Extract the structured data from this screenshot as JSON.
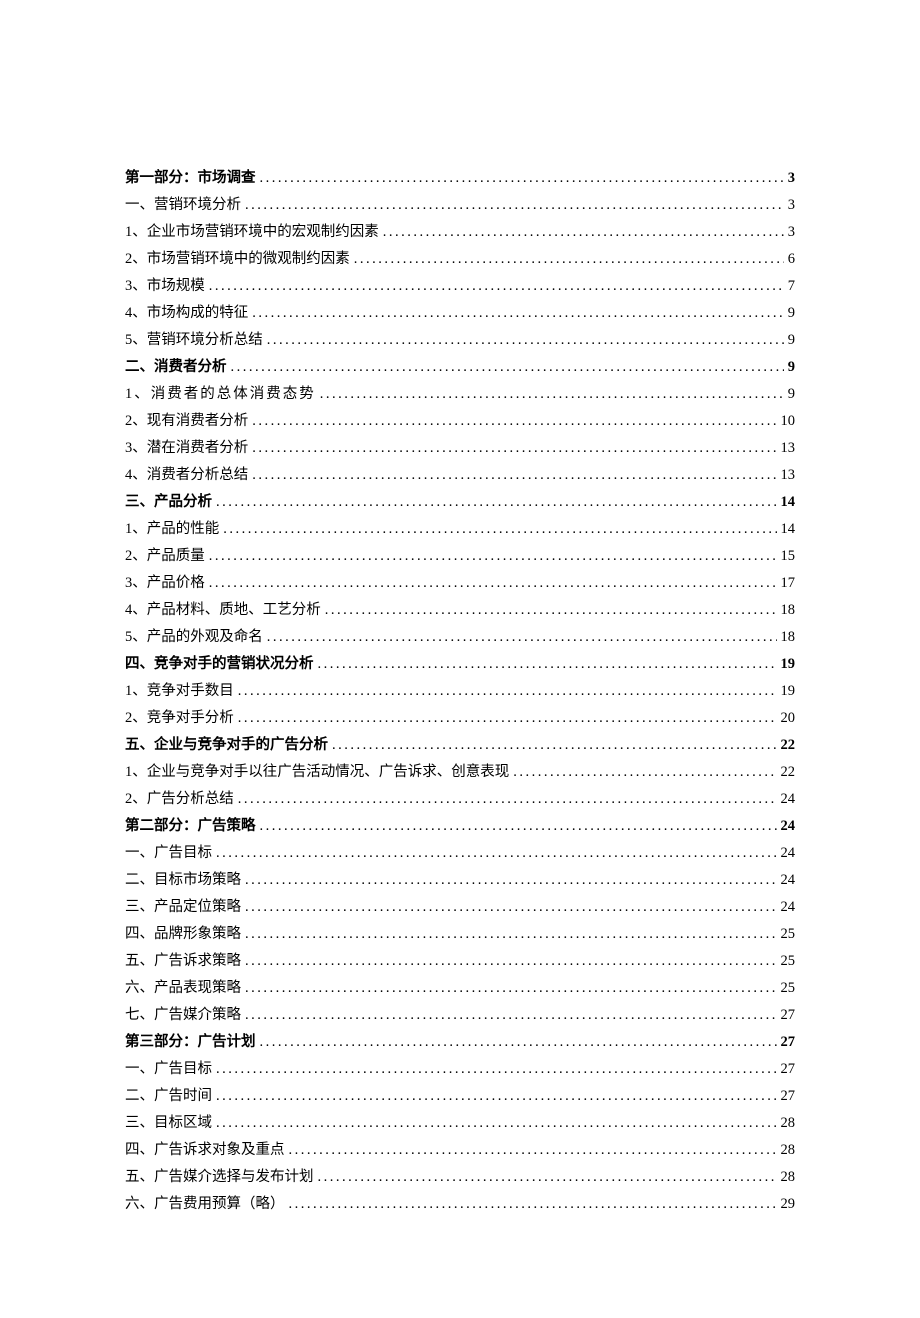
{
  "toc": [
    {
      "text": "第一部分：市场调查",
      "page": "3",
      "bold": true
    },
    {
      "text": "一、营销环境分析",
      "page": "3",
      "bold": false
    },
    {
      "text": "1、企业市场营销环境中的宏观制约因素",
      "page": "3",
      "bold": false
    },
    {
      "text": "2、市场营销环境中的微观制约因素",
      "page": "6",
      "bold": false
    },
    {
      "text": "3、市场规模",
      "page": "7",
      "bold": false
    },
    {
      "text": "4、市场构成的特征",
      "page": "9",
      "bold": false
    },
    {
      "text": "5、营销环境分析总结",
      "page": "9",
      "bold": false
    },
    {
      "text": "二、消费者分析",
      "page": "9",
      "bold": true
    },
    {
      "text": "1、消费者的总体消费态势",
      "page": "9",
      "bold": false,
      "spaced": true
    },
    {
      "text": "2、现有消费者分析",
      "page": "10",
      "bold": false
    },
    {
      "text": "3、潜在消费者分析",
      "page": "13",
      "bold": false
    },
    {
      "text": "4、消费者分析总结",
      "page": "13",
      "bold": false
    },
    {
      "text": "三、产品分析",
      "page": "14",
      "bold": true
    },
    {
      "text": "1、产品的性能",
      "page": "14",
      "bold": false
    },
    {
      "text": "2、产品质量",
      "page": "15",
      "bold": false
    },
    {
      "text": "3、产品价格",
      "page": "17",
      "bold": false
    },
    {
      "text": "4、产品材料、质地、工艺分析",
      "page": "18",
      "bold": false
    },
    {
      "text": "5、产品的外观及命名",
      "page": "18",
      "bold": false
    },
    {
      "text": "四、竞争对手的营销状况分析",
      "page": "19",
      "bold": true
    },
    {
      "text": "1、竞争对手数目",
      "page": "19",
      "bold": false
    },
    {
      "text": "2、竞争对手分析",
      "page": "20",
      "bold": false
    },
    {
      "text": "五、企业与竞争对手的广告分析",
      "page": "22",
      "bold": true
    },
    {
      "text": "1、企业与竞争对手以往广告活动情况、广告诉求、创意表现",
      "page": "22",
      "bold": false
    },
    {
      "text": "2、广告分析总结",
      "page": "24",
      "bold": false
    },
    {
      "text": "第二部分：广告策略",
      "page": "24",
      "bold": true
    },
    {
      "text": "一、广告目标",
      "page": "24",
      "bold": false
    },
    {
      "text": "二、目标市场策略",
      "page": "24",
      "bold": false
    },
    {
      "text": "三、产品定位策略",
      "page": "24",
      "bold": false
    },
    {
      "text": "四、品牌形象策略",
      "page": "25",
      "bold": false
    },
    {
      "text": "五、广告诉求策略",
      "page": "25",
      "bold": false
    },
    {
      "text": "六、产品表现策略",
      "page": "25",
      "bold": false
    },
    {
      "text": "七、广告媒介策略",
      "page": "27",
      "bold": false
    },
    {
      "text": "第三部分：广告计划",
      "page": "27",
      "bold": true
    },
    {
      "text": "一、广告目标",
      "page": "27",
      "bold": false
    },
    {
      "text": "二、广告时间",
      "page": "27",
      "bold": false
    },
    {
      "text": "三、目标区域",
      "page": "28",
      "bold": false
    },
    {
      "text": "四、广告诉求对象及重点",
      "page": "28",
      "bold": false
    },
    {
      "text": "五、广告媒介选择与发布计划",
      "page": "28",
      "bold": false
    },
    {
      "text": "六、广告费用预算（略）",
      "page": "29",
      "bold": false
    }
  ]
}
